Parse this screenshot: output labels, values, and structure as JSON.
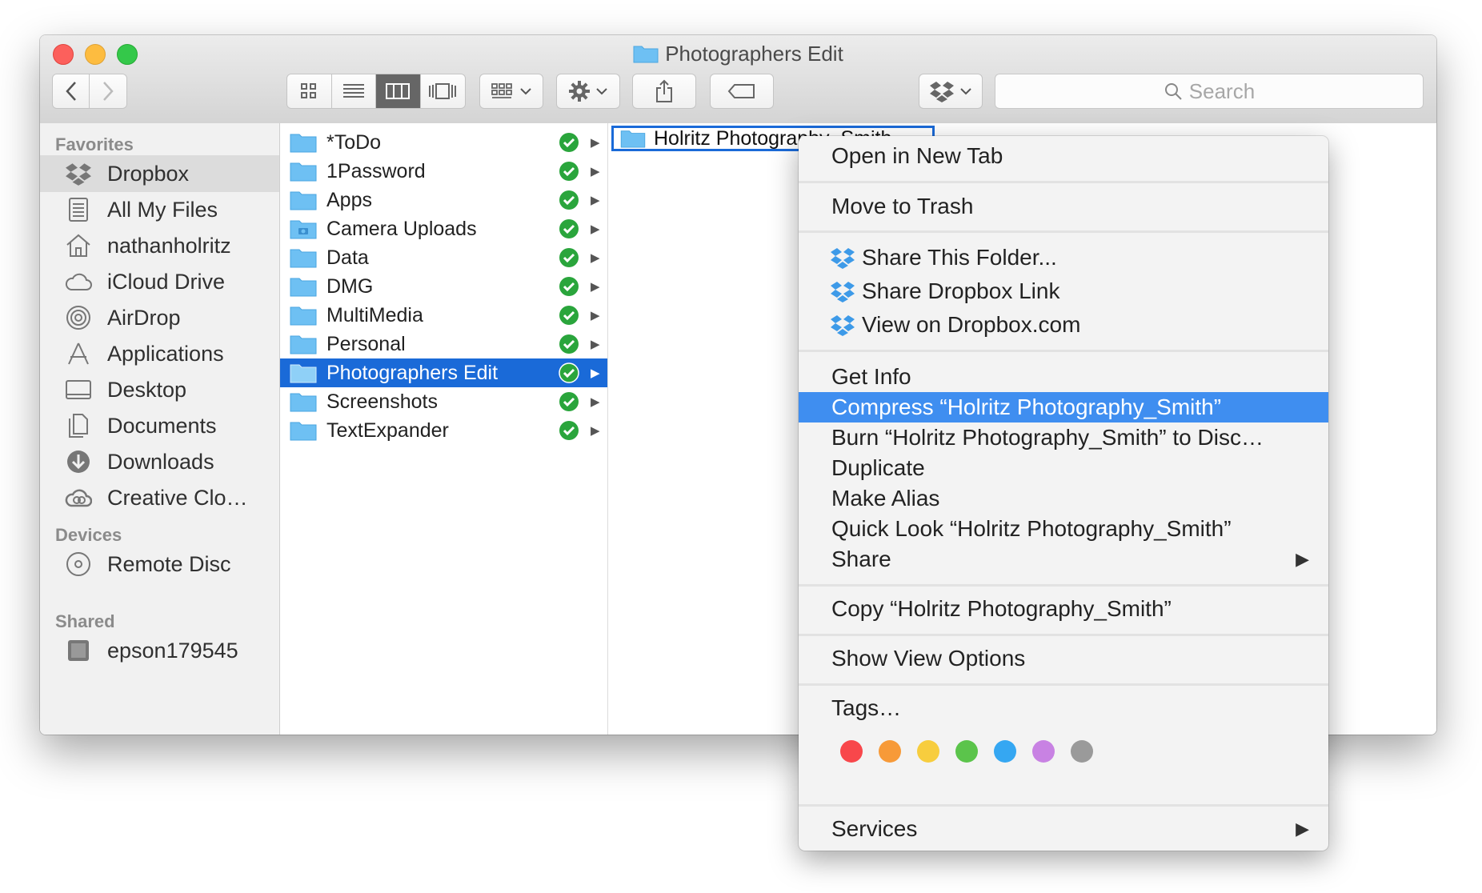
{
  "window": {
    "title": "Photographers Edit"
  },
  "toolbar": {
    "back_icon": "chevron-left-icon",
    "forward_icon": "chevron-right-icon",
    "search_placeholder": "Search"
  },
  "sidebar": {
    "favorites_header": "Favorites",
    "devices_header": "Devices",
    "shared_header": "Shared",
    "favorites": [
      {
        "label": "Dropbox",
        "icon": "dropbox-icon",
        "selected": true
      },
      {
        "label": "All My Files",
        "icon": "all-files-icon"
      },
      {
        "label": "nathanholritz",
        "icon": "home-icon"
      },
      {
        "label": "iCloud Drive",
        "icon": "cloud-icon"
      },
      {
        "label": "AirDrop",
        "icon": "airdrop-icon"
      },
      {
        "label": "Applications",
        "icon": "applications-icon"
      },
      {
        "label": "Desktop",
        "icon": "desktop-icon"
      },
      {
        "label": "Documents",
        "icon": "documents-icon"
      },
      {
        "label": "Downloads",
        "icon": "downloads-icon"
      },
      {
        "label": "Creative Clo…",
        "icon": "creative-cloud-icon"
      }
    ],
    "devices": [
      {
        "label": "Remote Disc",
        "icon": "disc-icon"
      }
    ],
    "shared": [
      {
        "label": "epson179545",
        "icon": "printer-icon"
      }
    ]
  },
  "column1": {
    "folders": [
      {
        "name": "*ToDo"
      },
      {
        "name": "1Password"
      },
      {
        "name": "Apps"
      },
      {
        "name": "Camera Uploads"
      },
      {
        "name": "Data"
      },
      {
        "name": "DMG"
      },
      {
        "name": "MultiMedia"
      },
      {
        "name": "Personal"
      },
      {
        "name": "Photographers Edit",
        "selected": true
      },
      {
        "name": "Screenshots"
      },
      {
        "name": "TextExpander"
      }
    ]
  },
  "column2": {
    "selected_folder": "Holritz Photography_Smith"
  },
  "context_menu": {
    "open_new_tab": "Open in New Tab",
    "move_to_trash": "Move to Trash",
    "share_folder": "Share This Folder...",
    "share_link": "Share Dropbox Link",
    "view_on_dropbox": "View on Dropbox.com",
    "get_info": "Get Info",
    "compress": "Compress “Holritz Photography_Smith”",
    "burn": "Burn “Holritz Photography_Smith” to Disc…",
    "duplicate": "Duplicate",
    "make_alias": "Make Alias",
    "quick_look": "Quick Look “Holritz Photography_Smith”",
    "share": "Share",
    "copy": "Copy “Holritz Photography_Smith”",
    "show_view_options": "Show View Options",
    "tags": "Tags…",
    "services": "Services",
    "tag_colors": [
      "#f8474b",
      "#f79a38",
      "#f7cd3e",
      "#5bc44b",
      "#35a7f2",
      "#c882e3",
      "#9a9a9a"
    ]
  },
  "colors": {
    "selection_blue": "#1a6ad8",
    "menu_highlight": "#3f8ef0",
    "folder_blue": "#6ec0f3",
    "sync_green": "#2aa53c"
  }
}
